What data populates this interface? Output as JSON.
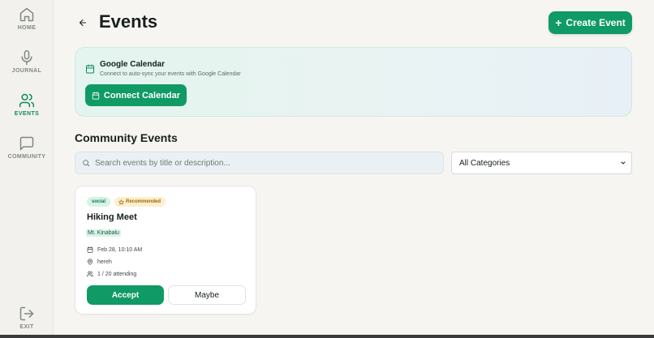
{
  "sidebar": {
    "items": [
      {
        "label": "HOME",
        "icon": "home-icon"
      },
      {
        "label": "JOURNAL",
        "icon": "mic-icon"
      },
      {
        "label": "EVENTS",
        "icon": "users-icon",
        "active": true
      },
      {
        "label": "COMMUNITY",
        "icon": "chat-icon"
      }
    ],
    "exit_label": "EXIT"
  },
  "header": {
    "title": "Events",
    "create_button": "Create Event"
  },
  "calendar": {
    "title": "Google Calendar",
    "subtitle": "Connect to auto-sync your events with Google Calendar",
    "connect_button": "Connect Calendar"
  },
  "community": {
    "section_title": "Community Events",
    "search_placeholder": "Search events by title or description...",
    "category_selected": "All Categories"
  },
  "event": {
    "tag": "social",
    "recommended": "Recommended",
    "title": "Hiking Meet",
    "organizer": "Mt. Kinabalu",
    "datetime": "Feb 28, 10:10 AM",
    "location": "hereh",
    "attending": "1 / 20 attending",
    "accept_button": "Accept",
    "maybe_button": "Maybe"
  },
  "colors": {
    "accent": "#0f9a66",
    "background": "#f7f5f2"
  }
}
